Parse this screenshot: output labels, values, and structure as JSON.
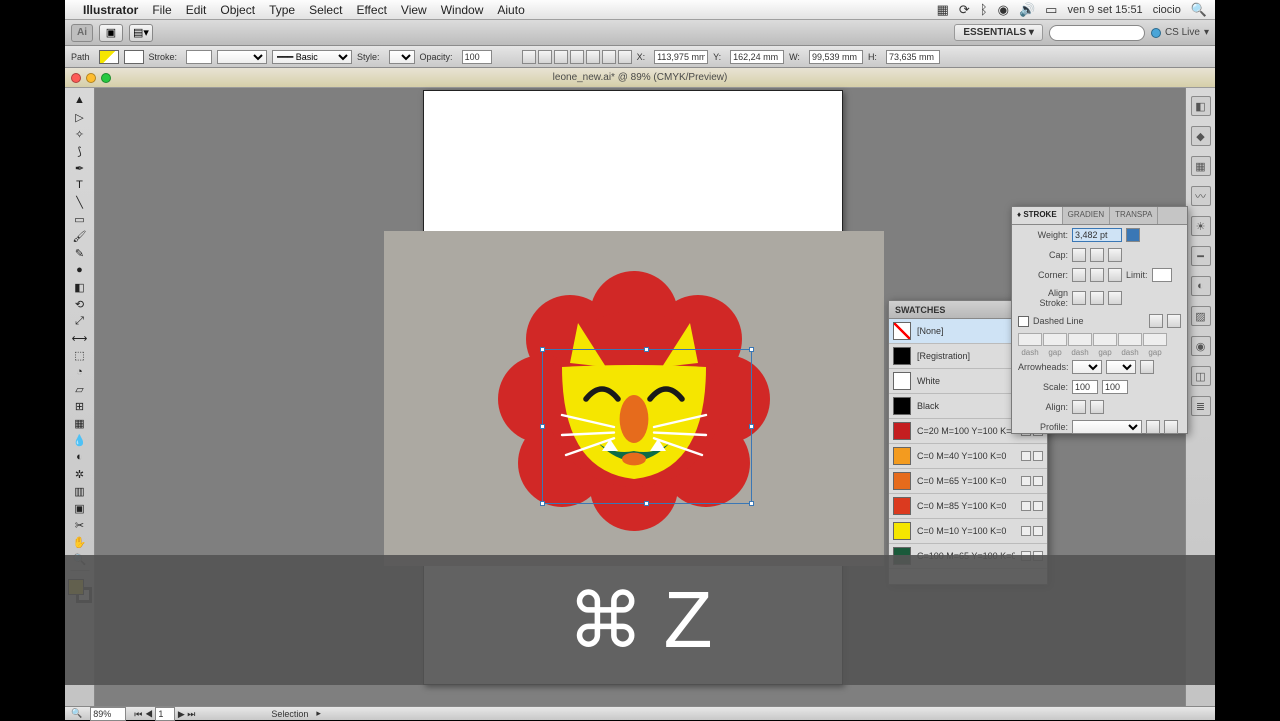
{
  "menubar": {
    "app": "Illustrator",
    "items": [
      "File",
      "Edit",
      "Object",
      "Type",
      "Select",
      "Effect",
      "View",
      "Window",
      "Aiuto"
    ],
    "clock": "ven 9 set  15:51",
    "user": "ciocio"
  },
  "toolbar": {
    "essentials": "ESSENTIALS",
    "cslive": "CS Live"
  },
  "options": {
    "selection": "Path",
    "stroke_label": "Stroke:",
    "stroke_style": "Basic",
    "style_label": "Style:",
    "opacity_label": "Opacity:",
    "opacity": "100",
    "x_label": "X:",
    "x": "113,975 mm",
    "y_label": "Y:",
    "y": "162,24 mm",
    "w_label": "W:",
    "w": "99,539 mm",
    "h_label": "H:",
    "h": "73,635 mm"
  },
  "document": {
    "title": "leone_new.ai* @ 89% (CMYK/Preview)"
  },
  "swatches": {
    "title": "SWATCHES",
    "items": [
      {
        "name": "[None]",
        "color": "none"
      },
      {
        "name": "[Registration]",
        "color": "#000000"
      },
      {
        "name": "White",
        "color": "#ffffff"
      },
      {
        "name": "Black",
        "color": "#000000"
      },
      {
        "name": "C=20 M=100 Y=100 K=0",
        "color": "#c41e20"
      },
      {
        "name": "C=0 M=40 Y=100 K=0",
        "color": "#f39b1f"
      },
      {
        "name": "C=0 M=65 Y=100 K=0",
        "color": "#e66b1c"
      },
      {
        "name": "C=0 M=85 Y=100 K=0",
        "color": "#db3a1f"
      },
      {
        "name": "C=0 M=10 Y=100 K=0",
        "color": "#f5e600"
      },
      {
        "name": "C=100 M=65 Y=100 K=0",
        "color": "#1a5a3a"
      }
    ]
  },
  "stroke": {
    "tabs": [
      "STROKE",
      "GRADIEN",
      "TRANSPA"
    ],
    "weight_label": "Weight:",
    "weight": "3,482 pt",
    "cap_label": "Cap:",
    "corner_label": "Corner:",
    "limit_label": "Limit:",
    "align_label": "Align Stroke:",
    "dashed": "Dashed Line",
    "dash_cols": [
      "dash",
      "gap",
      "dash",
      "gap",
      "dash",
      "gap"
    ],
    "arrow_label": "Arrowheads:",
    "scale_label": "Scale:",
    "scale1": "100",
    "scale2": "100",
    "align2_label": "Align:",
    "profile_label": "Profile:"
  },
  "status": {
    "zoom": "89%",
    "page": "1",
    "tool": "Selection"
  },
  "overlay": {
    "key": "Z"
  }
}
